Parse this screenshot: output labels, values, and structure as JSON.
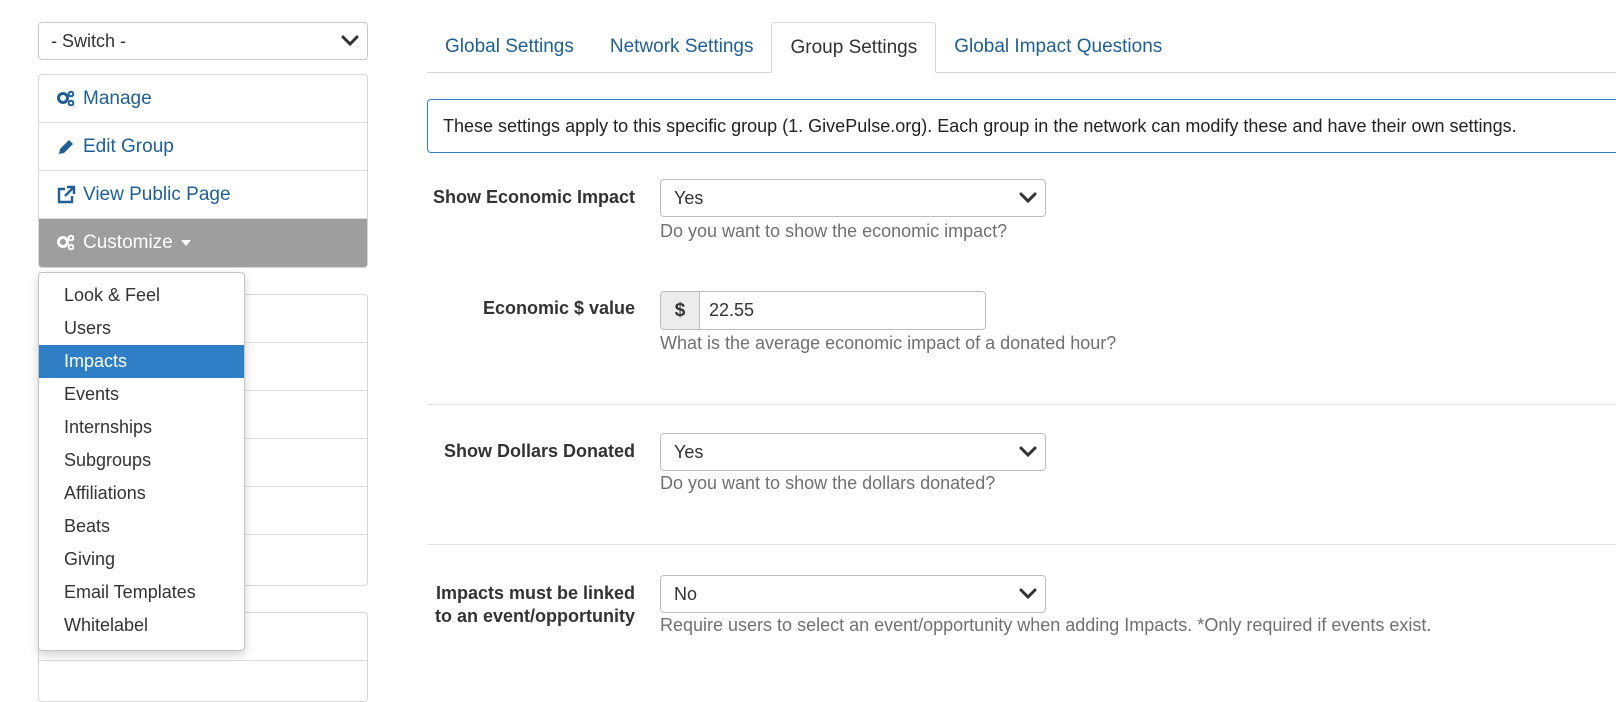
{
  "sidebar": {
    "switch_label": "- Switch -",
    "menu": [
      {
        "label": "Manage",
        "icon": "gears-icon"
      },
      {
        "label": "Edit Group",
        "icon": "pencil-icon"
      },
      {
        "label": "View Public Page",
        "icon": "external-link-icon"
      },
      {
        "label": "Customize",
        "icon": "gears-icon"
      }
    ],
    "customize_dropdown": [
      "Look & Feel",
      "Users",
      "Impacts",
      "Events",
      "Internships",
      "Subgroups",
      "Affiliations",
      "Beats",
      "Giving",
      "Email Templates",
      "Whitelabel"
    ],
    "selected_item": "Impacts"
  },
  "tabs": [
    "Global Settings",
    "Network Settings",
    "Group Settings",
    "Global Impact Questions"
  ],
  "active_tab": "Group Settings",
  "info_text": "These settings apply to this specific group (1. GivePulse.org). Each group in the network can modify these and have their own settings.",
  "form": {
    "show_economic_impact": {
      "label": "Show Economic Impact",
      "value": "Yes",
      "help": "Do you want to show the economic impact?"
    },
    "economic_value": {
      "label": "Economic $ value",
      "prefix": "$",
      "value": "22.55",
      "help": "What is the average economic impact of a donated hour?"
    },
    "show_dollars_donated": {
      "label": "Show Dollars Donated",
      "value": "Yes",
      "help": "Do you want to show the dollars donated?"
    },
    "impacts_linked": {
      "label_line1": "Impacts must be linked",
      "label_line2": "to an event/opportunity",
      "value": "No",
      "help": "Require users to select an event/opportunity when adding Impacts. *Only required if events exist."
    }
  },
  "colors": {
    "link": "#1f5f95",
    "selected": "#2f7fc6",
    "active_menu": "#9e9e9e"
  }
}
